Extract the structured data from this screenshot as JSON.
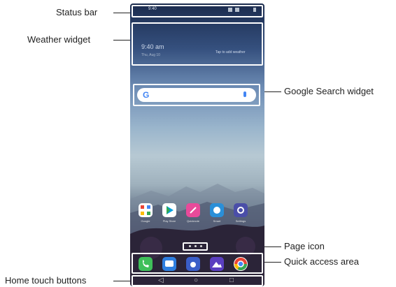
{
  "callouts": {
    "status_bar": "Status bar",
    "weather_widget": "Weather widget",
    "google_search_widget": "Google Search widget",
    "page_icon": "Page icon",
    "quick_access_area": "Quick access area",
    "home_touch_buttons": "Home touch buttons"
  },
  "phone": {
    "status_time": "9:40",
    "weather": {
      "time": "9:40 am",
      "date": "Thu, Aug 10",
      "tap": "Tap to add weather"
    },
    "search_logo": "G",
    "apps": [
      "Google",
      "Play Store",
      "Quicknote",
      "Smart",
      "Settings"
    ],
    "dock": [
      "phone-icon",
      "message-icon",
      "camera-icon",
      "gallery-icon",
      "chrome-icon"
    ],
    "nav": [
      "◁",
      "○",
      "□"
    ]
  }
}
